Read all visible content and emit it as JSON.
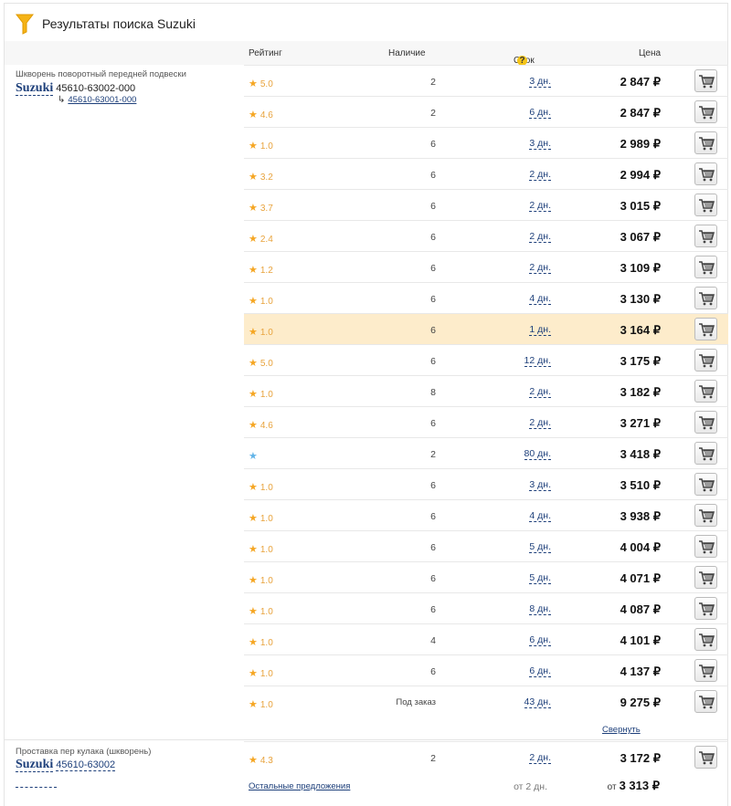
{
  "header": {
    "title": "Результаты поиска Suzuki"
  },
  "columns": {
    "rating": "Рейтинг",
    "stock": "Наличие",
    "term": "Срок",
    "term_help": "?",
    "price": "Цена"
  },
  "group1": {
    "description": "Шкворень поворотный передней подвески",
    "brand": "Suzuki",
    "number": "45610-63002-000",
    "analog_number": "45610-63001-000",
    "collapse_label": "Свернуть"
  },
  "offers": [
    {
      "rating": "5.0",
      "stock": "2",
      "term": "3 дн.",
      "price": "2 847 ₽"
    },
    {
      "rating": "4.6",
      "stock": "2",
      "term": "6 дн.",
      "price": "2 847 ₽"
    },
    {
      "rating": "1.0",
      "stock": "6",
      "term": "3 дн.",
      "price": "2 989 ₽"
    },
    {
      "rating": "3.2",
      "stock": "6",
      "term": "2 дн.",
      "price": "2 994 ₽"
    },
    {
      "rating": "3.7",
      "stock": "6",
      "term": "2 дн.",
      "price": "3 015 ₽"
    },
    {
      "rating": "2.4",
      "stock": "6",
      "term": "2 дн.",
      "price": "3 067 ₽"
    },
    {
      "rating": "1.2",
      "stock": "6",
      "term": "2 дн.",
      "price": "3 109 ₽"
    },
    {
      "rating": "1.0",
      "stock": "6",
      "term": "4 дн.",
      "price": "3 130 ₽"
    },
    {
      "rating": "1.0",
      "stock": "6",
      "term": "1 дн.",
      "price": "3 164 ₽"
    },
    {
      "rating": "5.0",
      "stock": "6",
      "term": "12 дн.",
      "price": "3 175 ₽"
    },
    {
      "rating": "1.0",
      "stock": "8",
      "term": "2 дн.",
      "price": "3 182 ₽"
    },
    {
      "rating": "4.6",
      "stock": "6",
      "term": "2 дн.",
      "price": "3 271 ₽"
    },
    {
      "rating": "",
      "stock": "2",
      "term": "80 дн.",
      "price": "3 418 ₽"
    },
    {
      "rating": "1.0",
      "stock": "6",
      "term": "3 дн.",
      "price": "3 510 ₽"
    },
    {
      "rating": "1.0",
      "stock": "6",
      "term": "4 дн.",
      "price": "3 938 ₽"
    },
    {
      "rating": "1.0",
      "stock": "6",
      "term": "5 дн.",
      "price": "4 004 ₽"
    },
    {
      "rating": "1.0",
      "stock": "6",
      "term": "5 дн.",
      "price": "4 071 ₽"
    },
    {
      "rating": "1.0",
      "stock": "6",
      "term": "8 дн.",
      "price": "4 087 ₽"
    },
    {
      "rating": "1.0",
      "stock": "4",
      "term": "6 дн.",
      "price": "4 101 ₽"
    },
    {
      "rating": "1.0",
      "stock": "6",
      "term": "6 дн.",
      "price": "4 137 ₽"
    },
    {
      "rating": "1.0",
      "stock": "Под заказ",
      "term": "43 дн.",
      "price": "9 275 ₽"
    }
  ],
  "highlighted_offer_index": 8,
  "group2": {
    "description": "Проставка пер кулака (шкворень)",
    "brand": "Suzuki",
    "number": "45610-63002",
    "offer": {
      "rating": "4.3",
      "stock": "2",
      "term": "2 дн.",
      "price": "3 172 ₽"
    },
    "more_label": "Остальные предложения",
    "other_term": "от 2 дн.",
    "other_price_prefix": "от",
    "other_price": "3 313 ₽"
  },
  "icons": {
    "filter": "funnel-icon",
    "star": "star-icon",
    "cart": "cart-icon"
  },
  "colors": {
    "accent": "#f5a623",
    "link": "#1d3f7a",
    "highlight": "#fdeccb"
  }
}
